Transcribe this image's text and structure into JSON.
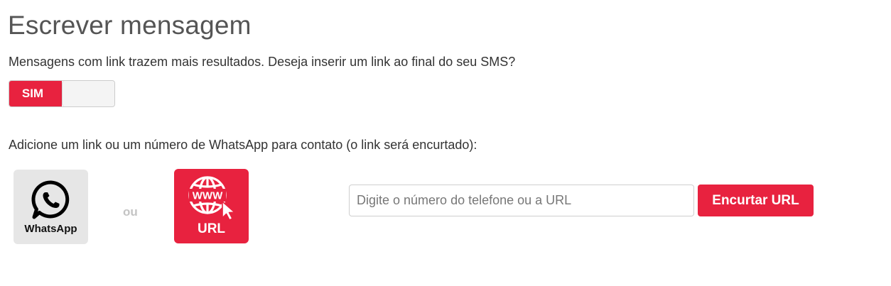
{
  "page": {
    "title": "Escrever mensagem",
    "question": "Mensagens com link trazem mais resultados. Deseja inserir um link ao final do seu SMS?",
    "instruction": "Adicione um link ou um número de WhatsApp para contato (o link será encurtado):"
  },
  "toggle": {
    "label": "SIM",
    "state": "on",
    "on_color": "#e8223f"
  },
  "options": {
    "whatsapp": {
      "label": "WhatsApp",
      "icon": "whatsapp-icon",
      "background": "#e6e6e6"
    },
    "separator": "ou",
    "url": {
      "label": "URL",
      "icon": "globe-www-cursor-icon",
      "background": "#e8223f"
    }
  },
  "link_input": {
    "placeholder": "Digite o número do telefone ou a URL",
    "value": ""
  },
  "shorten_button": {
    "label": "Encurtar URL",
    "color": "#e8223f"
  }
}
